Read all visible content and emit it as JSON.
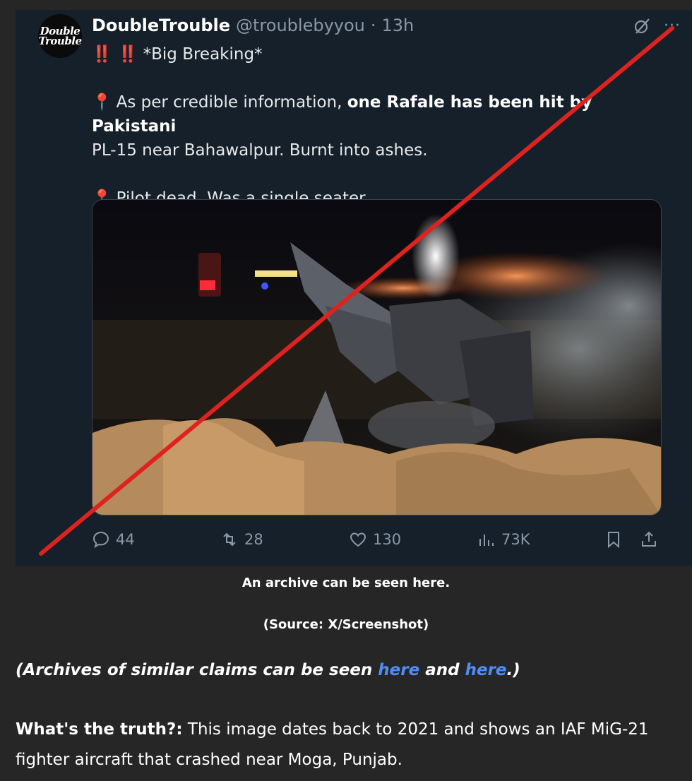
{
  "tweet": {
    "avatar_text_line1": "Double",
    "avatar_text_line2": "Trouble",
    "display_name": "DoubleTrouble",
    "handle": "@troublebyyou",
    "separator": "·",
    "time": "13h",
    "more_label": "···",
    "line1_bang": "‼️ ‼️",
    "line1_text": "*Big Breaking*",
    "line2_pin": "📍",
    "line2_prefix": "As per credible information, ",
    "line2_bold": "one Rafale has been hit by Pakistani",
    "line2_rest": "PL-15 near Bahawalpur.  Burnt into ashes.",
    "line3_pin": "📍",
    "line3_text": "Pilot dead. Was a single seater",
    "replies": "44",
    "reposts": "28",
    "likes": "130",
    "views": "73K"
  },
  "captions": {
    "archive": "An archive can be seen here.",
    "source": "(Source: X/Screenshot)"
  },
  "article": {
    "archives_prefix": "(Archives of similar claims can be seen ",
    "link1": "here",
    "archives_middle": " and ",
    "link2": "here",
    "archives_suffix": ".)",
    "truth_label": "What's the truth?:",
    "truth_text": " This image dates back to 2021 and shows an IAF MiG-21 fighter aircraft that crashed near Moga, Punjab."
  },
  "colors": {
    "page_bg": "#262626",
    "tweet_bg": "#15202b",
    "cross_red": "#e0221f",
    "link_blue": "#4f8ef7"
  }
}
